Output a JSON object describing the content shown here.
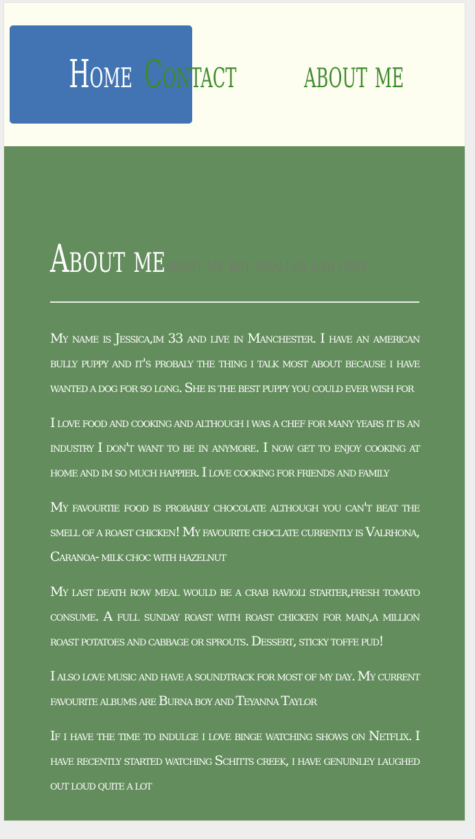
{
  "nav": {
    "items": [
      {
        "label": "Home",
        "active": true
      },
      {
        "label": "Contact",
        "active": false
      },
      {
        "label": "about me",
        "active": false
      }
    ]
  },
  "main": {
    "title": "About me",
    "subtitle": "about me but smaller and grey",
    "paragraphs": [
      "My name is Jessica,im 33 and live in Manchester. I have an american bully puppy and it's probaly the thing i talk most about because i have wanted a dog for so long. She is the best puppy you could ever wish for",
      "I love food and cooking and although i was a chef for many years it is an industry I don't want to be in anymore. I now get to enjoy cooking at home and im so much happier. I love cooking for friends and family",
      "My favourtie food is probably chocolate although you can't beat the smell of a roast chicken! My favourite choclate currently is Valrhona, Caranoa- milk choc with hazelnut",
      "My last death row meal would be a crab ravioli starter,fresh tomato consume. A full sunday roast with roast chicken for main,a million roast potatoes and cabbage or sprouts. Dessert, sticky toffe pud!",
      "I also love music and have a soundtrack for most of my day. My current favourite albums are Burna boy and Teyanna Taylor",
      "If i have the time to indulge i love binge watching shows on Netflix. I have recently started watching Schitts creek, i have genuinley laughed out loud quite a lot"
    ]
  },
  "colors": {
    "nav_background": "#fefef0",
    "nav_text": "#3e8a2c",
    "active_background": "#4274b4",
    "main_background": "#638d5c",
    "subtitle_text": "#777a70"
  }
}
